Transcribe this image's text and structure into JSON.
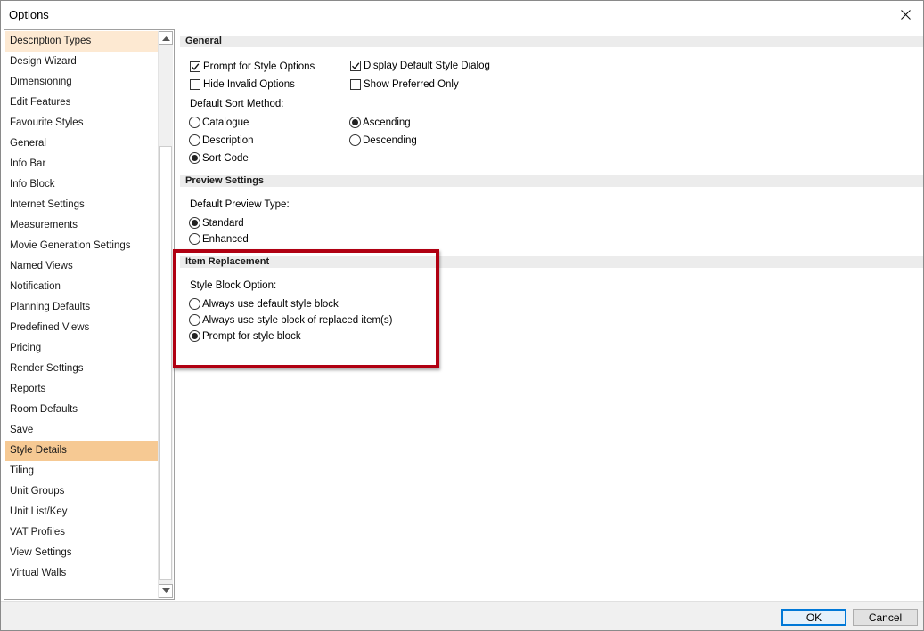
{
  "window": {
    "title": "Options",
    "close_icon": "close-icon"
  },
  "nav": {
    "items": [
      {
        "label": "Description Types",
        "state": "hover"
      },
      {
        "label": "Design Wizard"
      },
      {
        "label": "Dimensioning"
      },
      {
        "label": "Edit Features"
      },
      {
        "label": "Favourite Styles"
      },
      {
        "label": "General"
      },
      {
        "label": "Info Bar"
      },
      {
        "label": "Info Block"
      },
      {
        "label": "Internet Settings"
      },
      {
        "label": "Measurements"
      },
      {
        "label": "Movie Generation Settings"
      },
      {
        "label": "Named Views"
      },
      {
        "label": "Notification"
      },
      {
        "label": "Planning Defaults"
      },
      {
        "label": "Predefined Views"
      },
      {
        "label": "Pricing"
      },
      {
        "label": "Render Settings"
      },
      {
        "label": "Reports"
      },
      {
        "label": "Room Defaults"
      },
      {
        "label": "Save"
      },
      {
        "label": "Style Details",
        "state": "selected"
      },
      {
        "label": "Tiling"
      },
      {
        "label": "Unit Groups"
      },
      {
        "label": "Unit List/Key"
      },
      {
        "label": "VAT Profiles"
      },
      {
        "label": "View Settings"
      },
      {
        "label": "Virtual Walls"
      }
    ]
  },
  "general": {
    "header": "General",
    "prompt_style_options": {
      "label": "Prompt for Style Options",
      "checked": true
    },
    "display_default_style_dialog": {
      "label": "Display Default Style Dialog",
      "checked": true
    },
    "hide_invalid_options": {
      "label": "Hide Invalid Options",
      "checked": false
    },
    "show_preferred_only": {
      "label": "Show Preferred Only",
      "checked": false
    },
    "sort_method_label": "Default Sort Method:",
    "sort_catalogue": {
      "label": "Catalogue",
      "selected": false
    },
    "sort_description": {
      "label": "Description",
      "selected": false
    },
    "sort_code": {
      "label": "Sort Code",
      "selected": true
    },
    "order_ascending": {
      "label": "Ascending",
      "selected": true
    },
    "order_descending": {
      "label": "Descending",
      "selected": false
    }
  },
  "preview": {
    "header": "Preview Settings",
    "type_label": "Default Preview Type:",
    "standard": {
      "label": "Standard",
      "selected": true
    },
    "enhanced": {
      "label": "Enhanced",
      "selected": false
    }
  },
  "item_replacement": {
    "header": "Item Replacement",
    "style_block_label": "Style Block Option:",
    "always_default": {
      "label": "Always use default style block",
      "selected": false
    },
    "always_replaced": {
      "label": "Always use style block of replaced item(s)",
      "selected": false
    },
    "prompt": {
      "label": "Prompt for style block",
      "selected": true
    }
  },
  "footer": {
    "ok_label": "OK",
    "cancel_label": "Cancel"
  },
  "colors": {
    "highlight_box": "#b00012",
    "selected_item": "#f6c993",
    "hover_item": "#fde9d2",
    "default_button_border": "#0078d7"
  }
}
